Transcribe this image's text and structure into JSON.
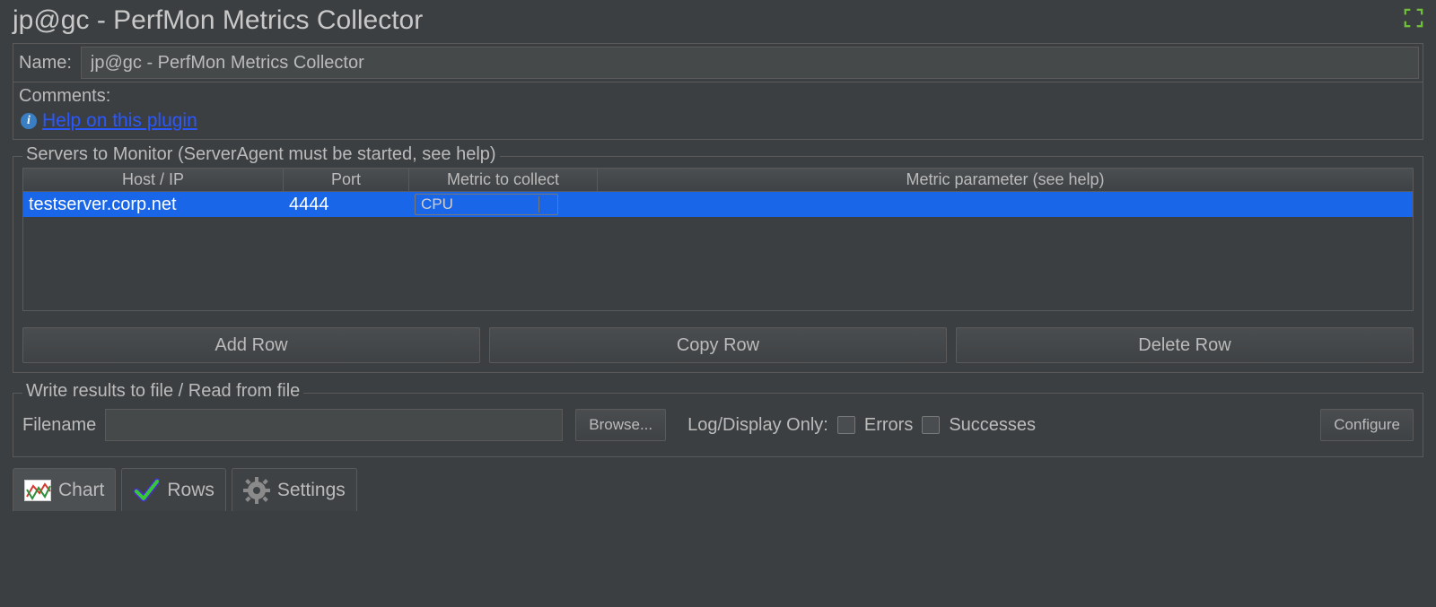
{
  "title": "jp@gc - PerfMon Metrics Collector",
  "name_label": "Name:",
  "name_value": "jp@gc - PerfMon Metrics Collector",
  "comments_label": "Comments:",
  "help_link_text": "Help on this plugin",
  "servers_group_legend": "Servers to Monitor (ServerAgent must be started, see help)",
  "table": {
    "headers": {
      "host": "Host / IP",
      "port": "Port",
      "metric": "Metric to collect",
      "param": "Metric parameter (see help)"
    },
    "rows": [
      {
        "host": "testserver.corp.net",
        "port": "4444",
        "metric": "CPU",
        "param": ""
      }
    ]
  },
  "buttons": {
    "add_row": "Add Row",
    "copy_row": "Copy Row",
    "delete_row": "Delete Row"
  },
  "file_group_legend": "Write results to file / Read from file",
  "file": {
    "filename_label": "Filename",
    "filename_value": "",
    "browse": "Browse...",
    "log_display_label": "Log/Display Only:",
    "errors_label": "Errors",
    "successes_label": "Successes",
    "configure": "Configure"
  },
  "tabs": {
    "chart": "Chart",
    "rows": "Rows",
    "settings": "Settings"
  }
}
